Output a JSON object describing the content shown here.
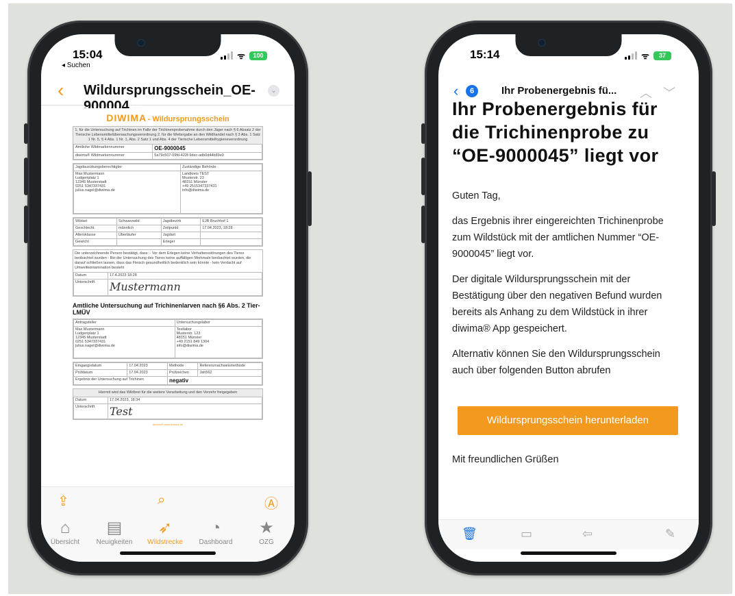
{
  "left_phone": {
    "status": {
      "time": "15:04",
      "back_app": "◂ Suchen",
      "battery": "100"
    },
    "nav": {
      "title": "Wildursprungsschein_OE-900004...",
      "back_icon": "chevron-left-icon",
      "more_icon": "chevron-down-circle-icon"
    },
    "document": {
      "brand": "DIWIMA",
      "brand_rest": "- Wildursprungsschein",
      "intro": "1. für die Untersuchung auf Trichinen im Falle der Trichinenprobenahme durch den Jäger nach § 6 Absatz 2 der Tierische Lebensmittelüberwachungsverordnung 2. für die Weitergabe an den Wildhandel nach § 3 Abs. 1 Satz 1 Nr. 5, § 4 Abs. 1 Nr. 1, Abs. 2 Satz 1 und Abs. 4 der Tierische Lebensmittelhygieneverordnung",
      "mark_label": "Amtliche Wildmarkennummer",
      "mark_value": "OE-9000045",
      "diwima_label": "diwima® Wildmarkennummer",
      "diwima_value": "5a79c507-09fd-422f-9dec-adb0d44b89e9",
      "hunter_label": "Jagdausübungsberechtigter",
      "hunter_text": "Max Mustermann\nLudgeriplatz 1\n12345 Musterstadt\n0251 5347337431\njulius.nagel@diwima.de",
      "authority_label": "Zuständige Behörde",
      "authority_text": "Landkreis TEST\nMusterstr. 23\n48151 Münster\n+49 2515347337431\ninfo@diwima.de",
      "rows": [
        [
          "Wildart",
          "Schwarzwild",
          "Jagdbezirk",
          "EJB Bruchhof 1"
        ],
        [
          "Geschlecht",
          "männlich",
          "Zeitpunkt",
          "17.04.2023, 18:28"
        ],
        [
          "Altersklasse",
          "Überläufer",
          "Jagdart",
          ""
        ],
        [
          "Gewicht",
          "",
          "Erleger",
          ""
        ]
      ],
      "confirm_text": "Die unterzeichnende Person bestätigt, dass: - Vor dem Erlegen keine Verhaltensstörungen des Tieres beobachtet wurden - Bei der Untersuchung des Tieres keine auffälligen Merkmale beobachtet wurden, die darauf schließen lassen, dass das Fleisch gesundheitlich bedenklich sein könnte - kein Verdacht auf Umweltkontamination besteht",
      "date_label": "Datum",
      "date_value": "17.4.2023 18:28",
      "sign_label": "Unterschrift",
      "sign_value": "Mustermann",
      "lab_title": "Amtliche Untersuchung auf Trichinenlarven nach §6 Abs. 2 Tier-LMÜV",
      "applicant_label": "Antragsteller",
      "applicant_text": "Max Mustermann\nLudgeriplatz 1\n12345 Musterstadt\n0251 5347337431\njulius.nagel@diwima.de",
      "lab_label": "Untersuchungslabor",
      "lab_text": "Testlabor\nMusterstr. 123\n48151 Münster\n+49 2151 849 1304\ninfo@diwima.de",
      "lab_rows": [
        [
          "Eingangsdatum",
          "17.04.2023",
          "Methode",
          "Referenznachweismethode"
        ],
        [
          "Prüfdatum",
          "17.04.2023",
          "Prüfzeichen",
          "Jah562"
        ]
      ],
      "result_label": "Ergebnis der Untersuchung auf Trichinen",
      "result_value": "negativ",
      "release_text": "Hiermit wird das Wildbret für die weitere Verarbeitung und den Verzehr freigegeben",
      "release_date_label": "Datum",
      "release_date_value": "17.04.2023, 18:34",
      "release_sign_label": "Unterschrift",
      "release_sign_value": "Test",
      "footer": "diwima® www.diwima.de"
    },
    "toolbar": {
      "share_icon": "share-icon",
      "search_icon": "search-icon",
      "markup_icon": "markup-icon"
    },
    "tabs": [
      {
        "label": "Übersicht",
        "icon": "home-icon"
      },
      {
        "label": "Neuigkeiten",
        "icon": "news-icon"
      },
      {
        "label": "Wildstrecke",
        "icon": "wildstrecke-icon"
      },
      {
        "label": "Dashboard",
        "icon": "dashboard-icon"
      },
      {
        "label": "OZG",
        "icon": "star-icon"
      }
    ]
  },
  "right_phone": {
    "status": {
      "time": "15:14",
      "battery": "37"
    },
    "nav": {
      "badge": "6",
      "subject": "Ihr Probenergebnis fü..."
    },
    "mail": {
      "heading": "Ihr Probenergebnis für die Trichinenprobe zu “OE-9000045” liegt vor",
      "greeting": "Guten Tag,",
      "p1": "das Ergebnis ihrer eingereichten Trichinenprobe zum Wildstück mit der amtlichen Nummer “OE-9000045” liegt vor.",
      "p2": "Der digitale Wildursprungsschein mit der Bestätigung über den negativen Befund wurden bereits als Anhang zu dem Wildstück in ihrer diwima® App gespeichert.",
      "p3": "Alternativ können Sie den Wildursprungsschein auch über folgenden Button abrufen",
      "button": "Wildursprungsschein herunterladen",
      "closing": "Mit freundlichen Grüßen"
    },
    "toolbar": {
      "icons": [
        "trash-icon",
        "folder-icon",
        "reply-icon",
        "compose-icon"
      ]
    }
  },
  "colors": {
    "accent": "#f39a1e",
    "link_blue": "#1a73e8",
    "backdrop": "#dfe2dc"
  }
}
